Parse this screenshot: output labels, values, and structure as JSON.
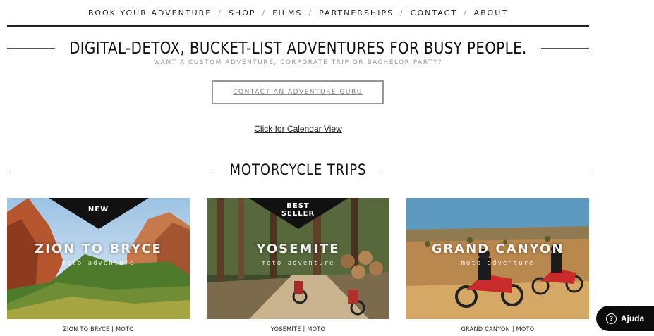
{
  "nav": {
    "items": [
      "BOOK YOUR ADVENTURE",
      "SHOP",
      "FILMS",
      "PARTNERSHIPS",
      "CONTACT",
      "ABOUT"
    ],
    "separator": "/"
  },
  "hero": {
    "headline": "DIGITAL-DETOX, BUCKET-LIST ADVENTURES FOR BUSY PEOPLE.",
    "subline": "WANT A CUSTOM ADVENTURE, CORPORATE TRIP OR BACHELOR PARTY?",
    "cta_label": "CONTACT AN ADVENTURE GURU",
    "calendar_link": "Click for Calendar View"
  },
  "section": {
    "title": "MOTORCYCLE TRIPS"
  },
  "trips": [
    {
      "name": "ZION TO BRYCE",
      "kind": "moto adventure",
      "badge_line1": "NEW",
      "badge_line2": "",
      "caption": "ZION TO BRYCE | MOTO"
    },
    {
      "name": "YOSEMITE",
      "kind": "moto adventure",
      "badge_line1": "BEST",
      "badge_line2": "SELLER",
      "caption": "YOSEMITE | MOTO"
    },
    {
      "name": "GRAND CANYON",
      "kind": "moto adventure",
      "badge_line1": "",
      "badge_line2": "",
      "caption": "GRAND CANYON | MOTO"
    }
  ],
  "help": {
    "label": "Ajuda",
    "icon": "question-circle-icon"
  },
  "colors": {
    "text": "#222222",
    "muted": "#9a9a9a",
    "badge": "#111111",
    "help_bg": "#0c0c0c"
  }
}
